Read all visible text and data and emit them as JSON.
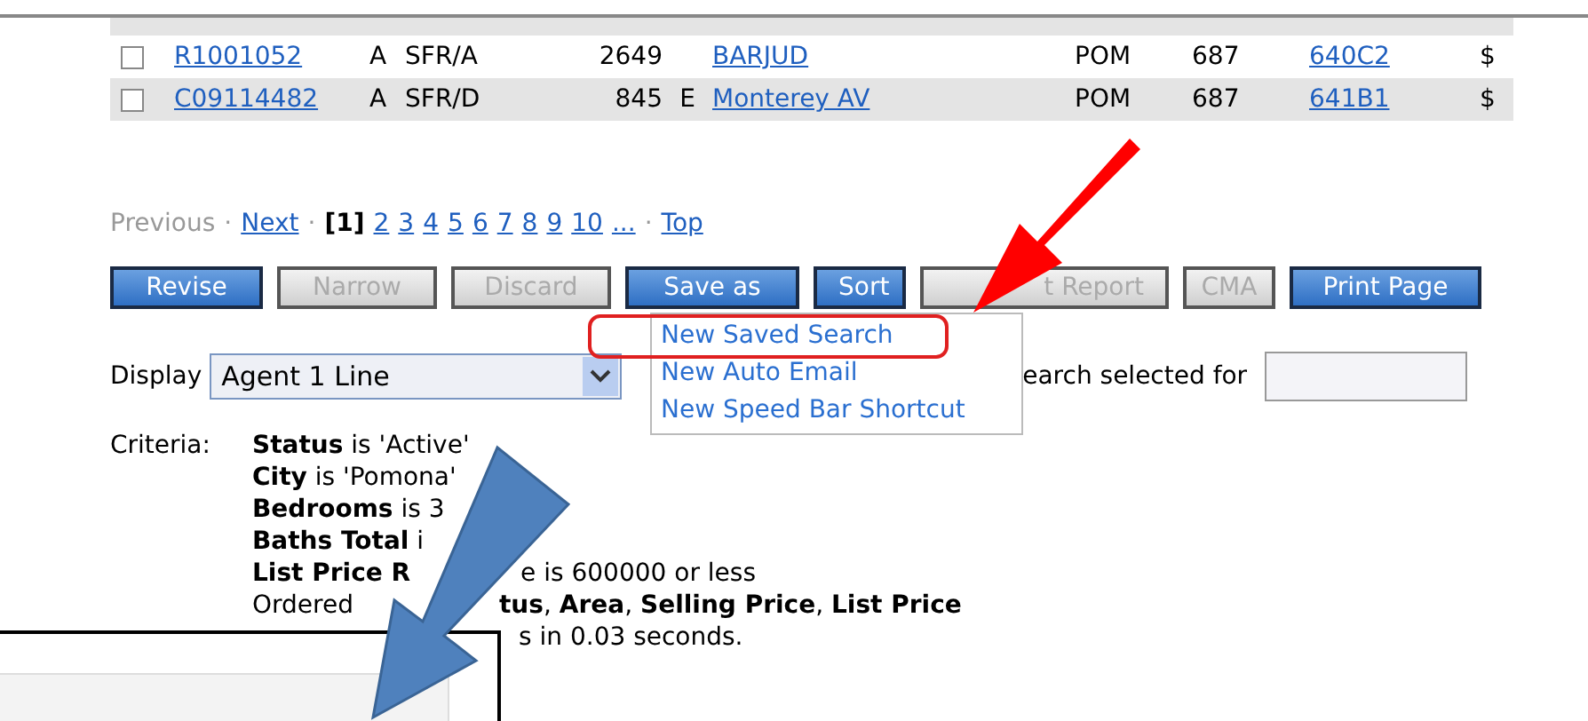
{
  "rows": [
    {
      "checked": false,
      "id": "R1001052",
      "status": "A",
      "type": "SFR/A",
      "number": "2649",
      "dir": "",
      "street": "BARJUD",
      "city": "POM",
      "area": "687",
      "map": "640C2",
      "price": "$"
    },
    {
      "checked": false,
      "id": "C09114482",
      "status": "A",
      "type": "SFR/D",
      "number": "845",
      "dir": "E",
      "street": "Monterey AV",
      "city": "POM",
      "area": "687",
      "map": "641B1",
      "price": "$"
    }
  ],
  "pager": {
    "previous": "Previous",
    "sep": "·",
    "next": "Next",
    "current": "[1]",
    "pages": [
      "2",
      "3",
      "4",
      "5",
      "6",
      "7",
      "8",
      "9",
      "10",
      "..."
    ],
    "top": "Top"
  },
  "buttons": [
    {
      "label": "Revise",
      "disabled": false
    },
    {
      "label": "Narrow",
      "disabled": true
    },
    {
      "label": "Discard",
      "disabled": true
    },
    {
      "label": "Save as",
      "disabled": false
    },
    {
      "label": "Sort",
      "disabled": false
    },
    {
      "label": "t Report",
      "disabled": true
    },
    {
      "label": "CMA",
      "disabled": true
    },
    {
      "label": "Print Page",
      "disabled": false
    }
  ],
  "menu": [
    {
      "label": "New Saved Search",
      "highlighted": true
    },
    {
      "label": "New Auto Email",
      "highlighted": false
    },
    {
      "label": "New Speed Bar Shortcut",
      "highlighted": false
    }
  ],
  "display": {
    "label": "Display",
    "value": "Agent 1 Line"
  },
  "search_selected": {
    "label": "earch selected for"
  },
  "criteria": {
    "label": "Criteria:",
    "lines": [
      [
        "**Status** is 'Active'"
      ],
      [
        "**City** is 'Pomona'"
      ],
      [
        "**Bedrooms** is 3"
      ],
      [
        "**Baths Total** i"
      ],
      [
        "**List Price R**",
        "e is 600000 or less"
      ],
      [
        "Ordered",
        "**tus**, **Area**, **Selling Price**, **List Price**"
      ],
      [
        "s in 0.03 seconds."
      ]
    ]
  }
}
